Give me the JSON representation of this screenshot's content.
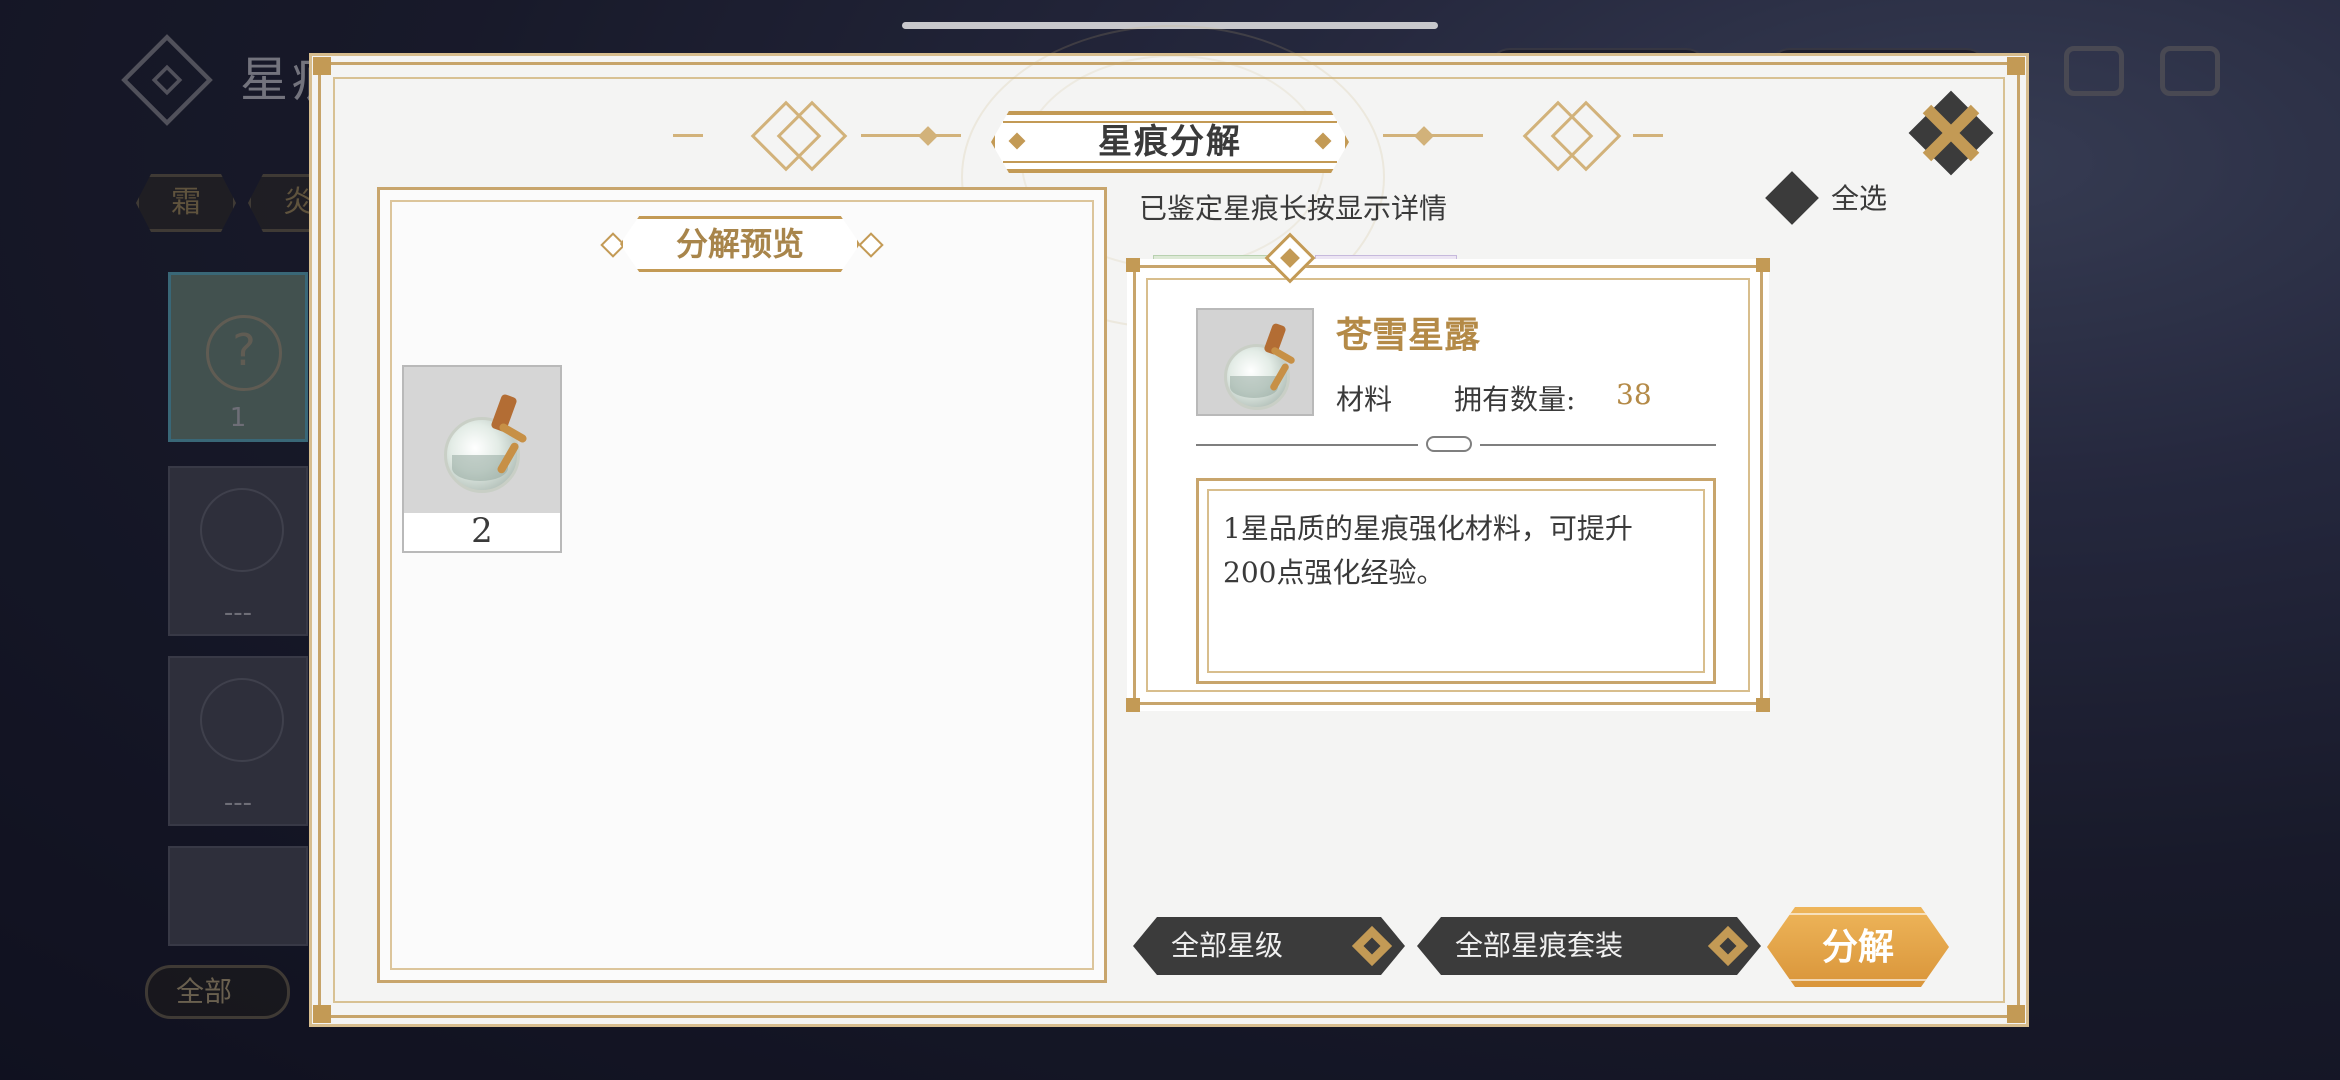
{
  "background": {
    "title": "星痕养成·约项之刻",
    "tabs": [
      "霜",
      "炎"
    ],
    "cards": [
      {
        "count": "1"
      },
      {
        "count": "---"
      },
      {
        "count": "---"
      }
    ],
    "filter_label": "全部"
  },
  "dialog": {
    "title": "星痕分解",
    "close_icon": "close-x-icon"
  },
  "preview": {
    "title": "分解预览",
    "items": [
      {
        "name": "苍雪星露",
        "count": "2"
      }
    ]
  },
  "hint": "已鉴定星痕长按显示详情",
  "select_all": {
    "label": "全选",
    "checked": false
  },
  "detail": {
    "name": "苍雪星露",
    "type": "材料",
    "owned_label": "拥有数量:",
    "owned_value": "38",
    "description": "1星品质的星痕强化材料，可提升200点强化经验。"
  },
  "buttons": {
    "star_filter": "全部星级",
    "set_filter": "全部星痕套装",
    "decompose": "分解"
  },
  "colors": {
    "gold": "#c39a55",
    "dark": "#3b3b3b",
    "accent_orange": "#e5a24a"
  }
}
